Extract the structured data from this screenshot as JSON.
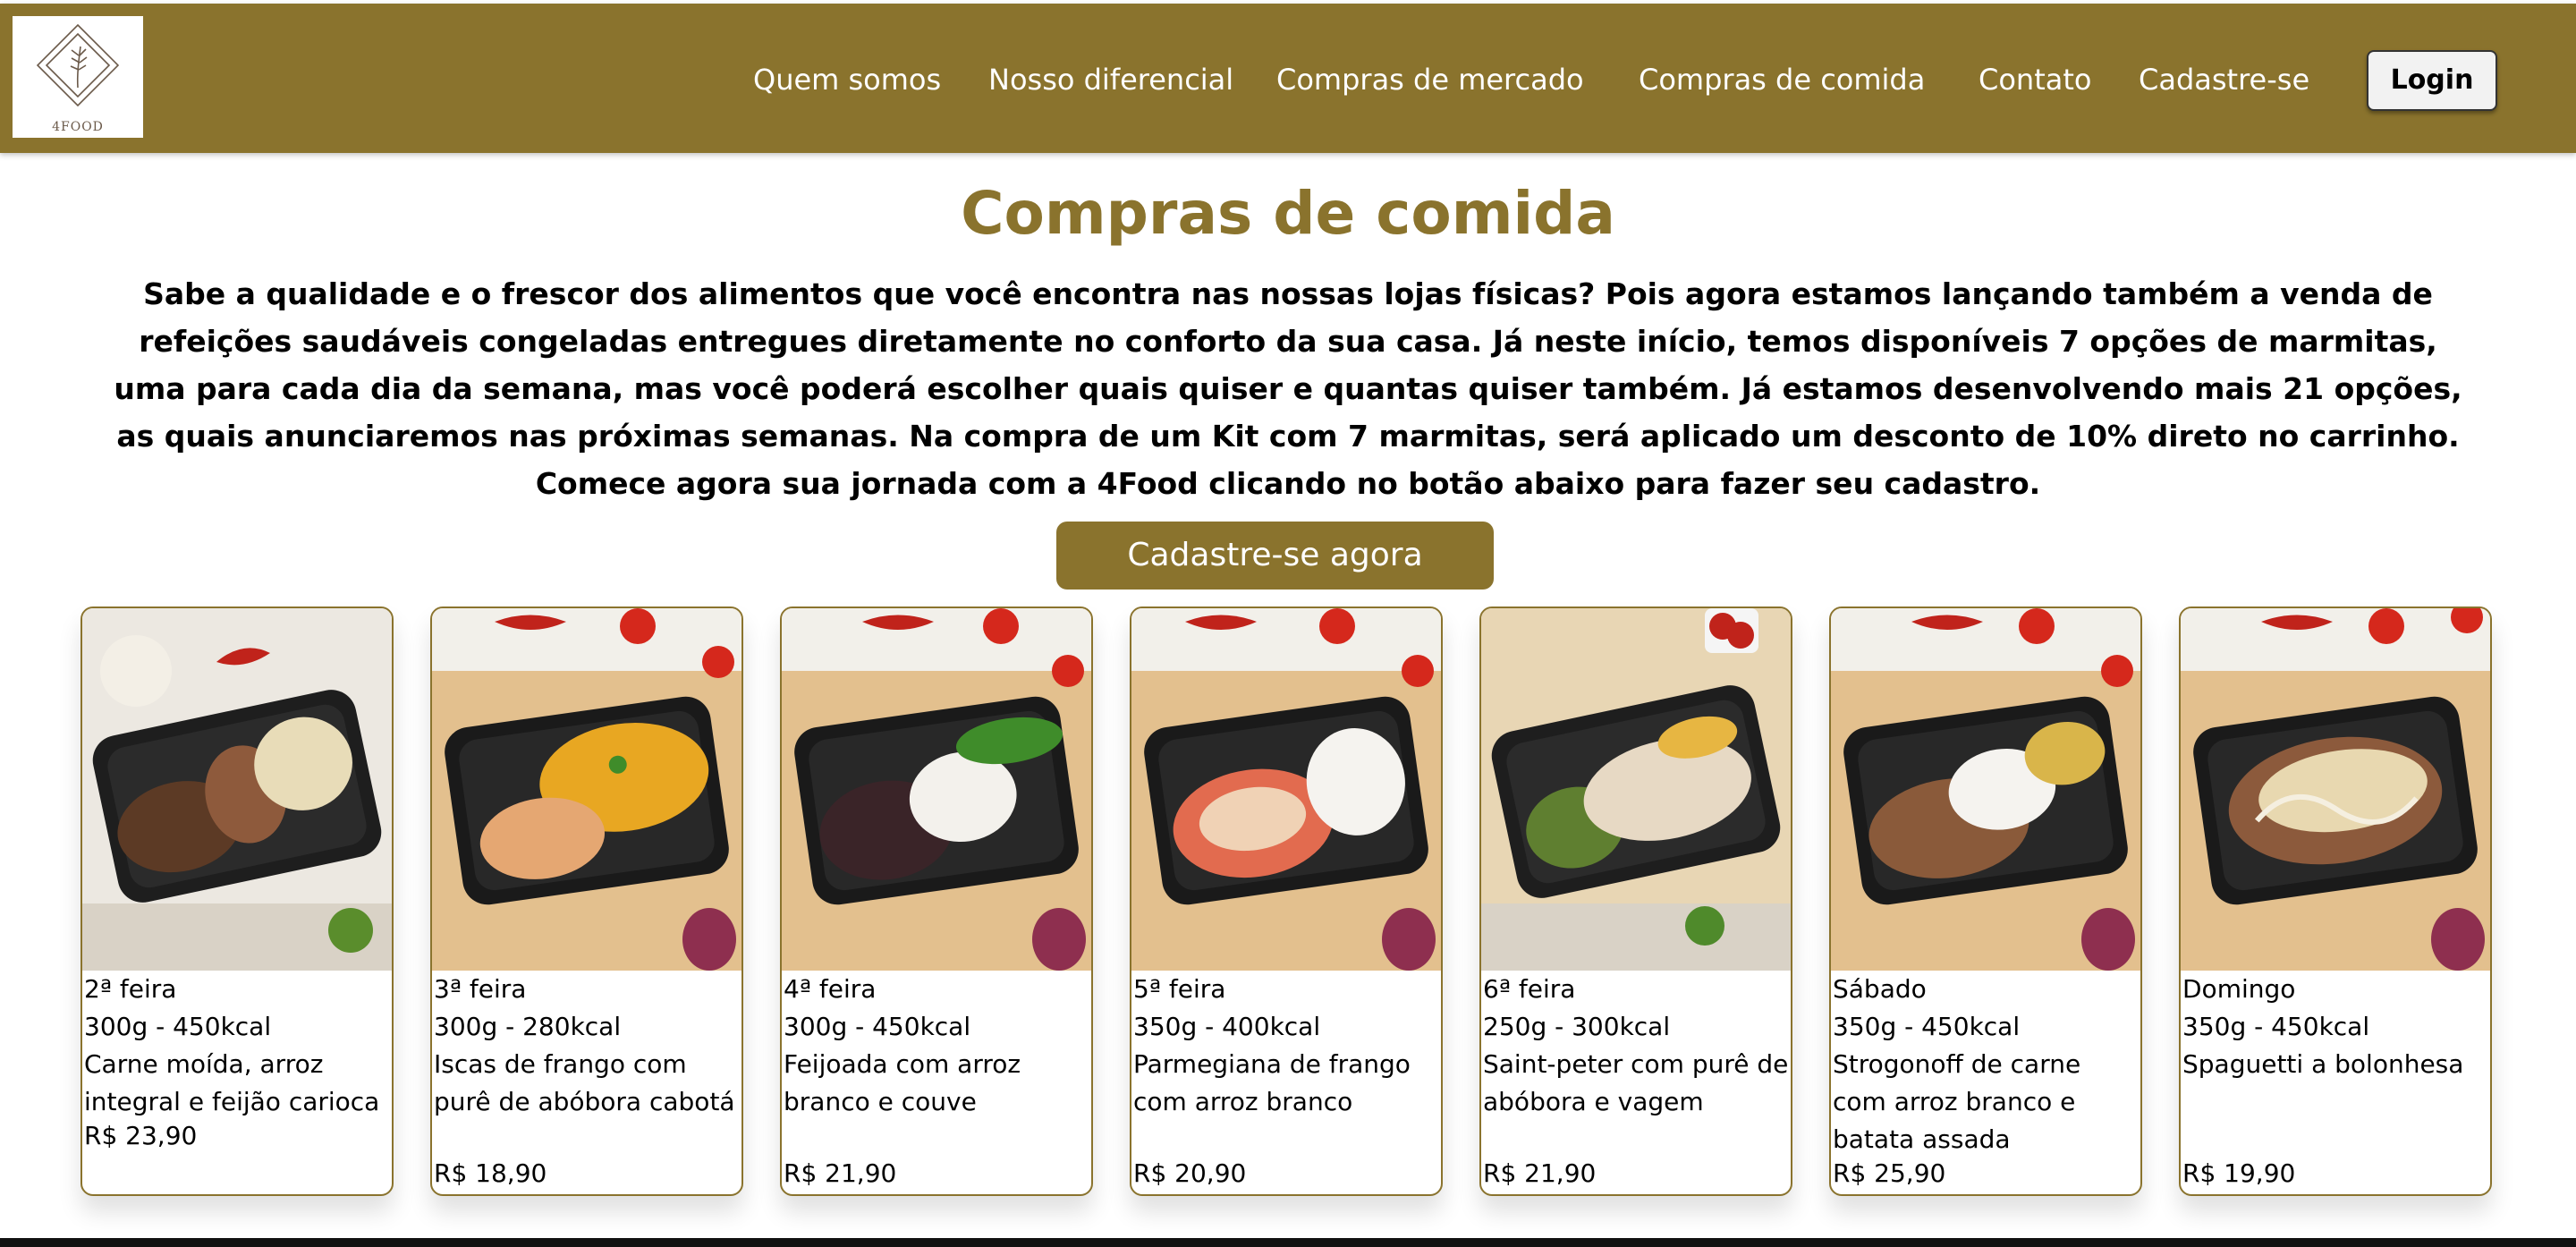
{
  "brand": {
    "logo_text": "4FOOD",
    "accent_color": "#8a732d"
  },
  "nav": {
    "items": [
      "Quem somos",
      "Nosso diferencial",
      "Compras de mercado",
      "Compras de comida",
      "Contato",
      "Cadastre-se"
    ],
    "login_label": "Login"
  },
  "main": {
    "title": "Compras de comida",
    "intro": "Sabe a qualidade e o frescor dos alimentos que você encontra nas nossas lojas físicas? Pois agora estamos lançando também a venda de refeições saudáveis congeladas entregues diretamente no conforto da sua casa. Já neste início, temos disponíveis 7 opções de marmitas, uma para cada dia da semana, mas você poderá escolher quais quiser e quantas quiser também. Já estamos desenvolvendo mais 21 opções, as quais anunciaremos nas próximas semanas. Na compra de um Kit com 7 marmitas, será aplicado um desconto de 10% direto no carrinho. Comece agora sua jornada com a 4Food clicando no botão abaixo para fazer seu cadastro.",
    "cta_label": "Cadastre-se agora"
  },
  "cards": [
    {
      "day": "2ª feira",
      "info": "300g - 450kcal",
      "description": "Carne moída, arroz integral e feijão carioca",
      "price": "R$ 23,90"
    },
    {
      "day": "3ª feira",
      "info": "300g - 280kcal",
      "description": "Iscas de frango com purê de abóbora cabotá",
      "price": "R$ 18,90"
    },
    {
      "day": "4ª feira",
      "info": "300g - 450kcal",
      "description": "Feijoada com arroz branco e couve",
      "price": "R$ 21,90"
    },
    {
      "day": "5ª feira",
      "info": "350g - 400kcal",
      "description": "Parmegiana de frango com arroz branco",
      "price": "R$ 20,90"
    },
    {
      "day": "6ª feira",
      "info": "250g - 300kcal",
      "description": "Saint-peter com purê de abóbora e vagem",
      "price": "R$ 21,90"
    },
    {
      "day": "Sábado",
      "info": "350g - 450kcal",
      "description": "Strogonoff de carne com arroz branco e batata assada",
      "price": "R$ 25,90"
    },
    {
      "day": "Domingo",
      "info": "350g - 450kcal",
      "description": "Spaguetti a bolonhesa",
      "price": "R$ 19,90"
    }
  ]
}
